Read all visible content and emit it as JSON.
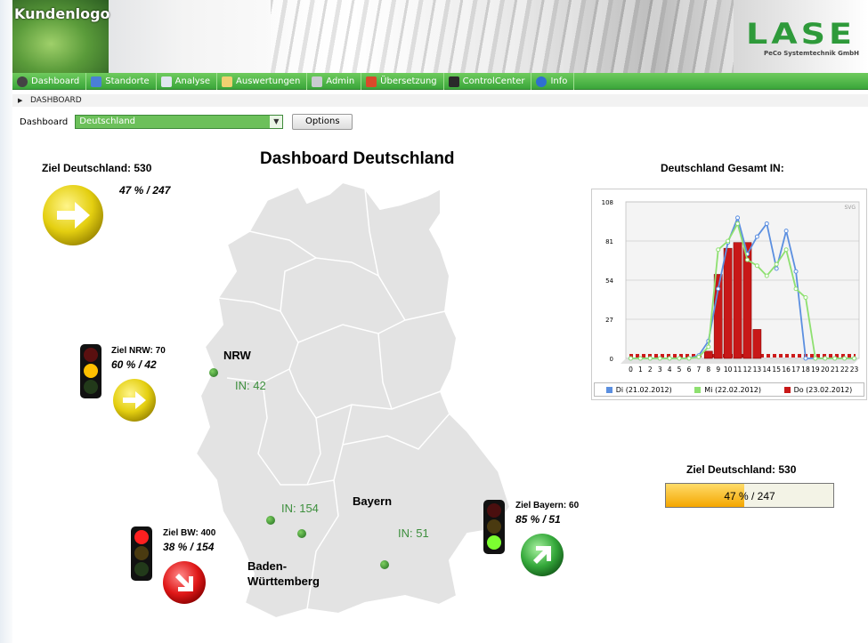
{
  "header": {
    "customer_logo": "Kundenlogo",
    "vendor_logo": "LASE",
    "vendor_sub": "PeCo Systemtechnik GmbH"
  },
  "menu": [
    {
      "label": "Dashboard",
      "icon": "dashboard-icon",
      "color": "#444444"
    },
    {
      "label": "Standorte",
      "icon": "pin-icon",
      "color": "#4a7fd6"
    },
    {
      "label": "Analyse",
      "icon": "document-icon",
      "color": "#dfe6ee"
    },
    {
      "label": "Auswertungen",
      "icon": "report-icon",
      "color": "#f0d070"
    },
    {
      "label": "Admin",
      "icon": "tools-icon",
      "color": "#c9cbd0"
    },
    {
      "label": "Übersetzung",
      "icon": "flag-icon",
      "color": "#d94a2a"
    },
    {
      "label": "ControlCenter",
      "icon": "control-icon",
      "color": "#2a2a2a"
    },
    {
      "label": "Info",
      "icon": "info-icon",
      "color": "#2f6fd0"
    }
  ],
  "breadcrumb": "DASHBOARD",
  "dashboard_selector": {
    "label": "Dashboard",
    "value": "Deutschland",
    "options_button": "Options"
  },
  "title": "Dashboard Deutschland",
  "goal_germany": {
    "label": "Ziel Deutschland: 530",
    "value": "47 % / 247",
    "percent": 47
  },
  "regions": {
    "nrw": {
      "goal": "Ziel NRW: 70",
      "value": "60 % / 42",
      "name": "NRW",
      "in": "IN: 42",
      "light": "yellow"
    },
    "bw": {
      "goal": "Ziel BW: 400",
      "value": "38 % / 154",
      "name": "Baden-\nWürttemberg",
      "in": "IN: 154",
      "light": "red"
    },
    "bayern": {
      "goal": "Ziel Bayern: 60",
      "value": "85 % / 51",
      "name": "Bayern",
      "in": "IN: 51",
      "light": "green"
    }
  },
  "chart_title": "Deutschland Gesamt IN:",
  "progress_goal": "Ziel Deutschland: 530",
  "progress_text": "47 % / 247",
  "chart_data": {
    "type": "line",
    "title": "Deutschland Gesamt IN:",
    "x": [
      0,
      1,
      2,
      3,
      4,
      5,
      6,
      7,
      8,
      9,
      10,
      11,
      12,
      13,
      14,
      15,
      16,
      17,
      18,
      19,
      20,
      21,
      22,
      23
    ],
    "ylim": [
      0,
      108
    ],
    "yticks": [
      0,
      27,
      54,
      81,
      108
    ],
    "watermark": "SVG",
    "series": [
      {
        "name": "Di (21.02.2012)",
        "type": "line",
        "color": "#5b8fe0",
        "values": [
          0,
          0,
          0,
          0,
          0,
          0,
          0,
          2,
          12,
          48,
          80,
          97,
          72,
          84,
          93,
          62,
          88,
          60,
          0,
          0,
          0,
          0,
          0,
          0
        ]
      },
      {
        "name": "Mi (22.02.2012)",
        "type": "line",
        "color": "#8ee070",
        "values": [
          0,
          0,
          0,
          0,
          0,
          0,
          0,
          1,
          8,
          75,
          81,
          93,
          68,
          64,
          57,
          65,
          75,
          48,
          42,
          0,
          0,
          0,
          0,
          0
        ]
      },
      {
        "name": "Do (23.02.2012)",
        "type": "bar",
        "color": "#c81818",
        "values": [
          0,
          0,
          0,
          0,
          0,
          0,
          0,
          0,
          5,
          58,
          76,
          80,
          80,
          20,
          0,
          0,
          0,
          0,
          0,
          0,
          0,
          0,
          0,
          0
        ]
      }
    ]
  }
}
